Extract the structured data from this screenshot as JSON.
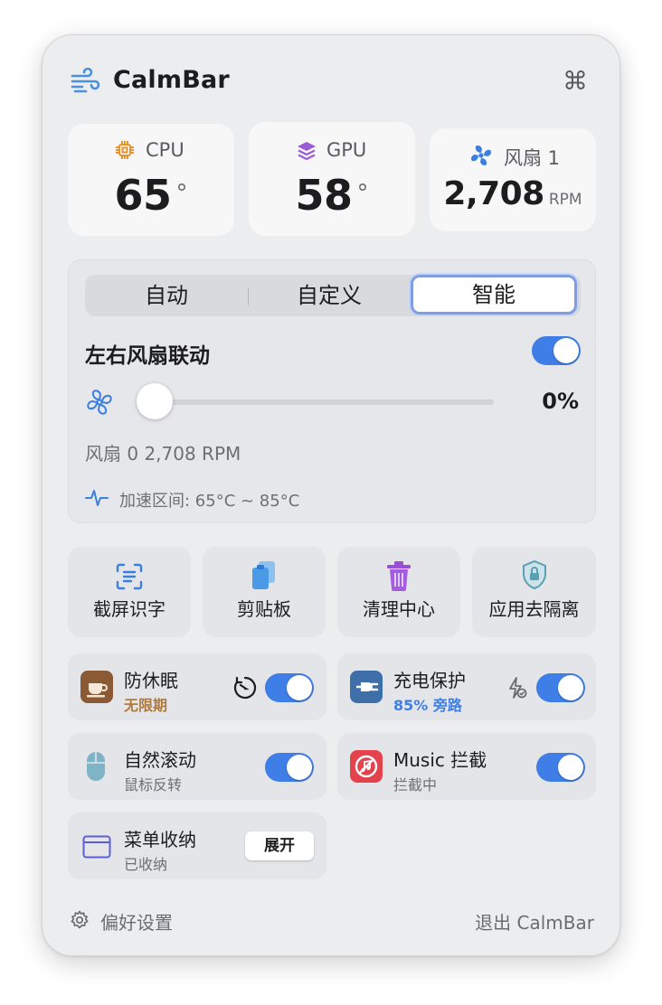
{
  "header": {
    "title": "CalmBar",
    "app_icon": "wind-icon",
    "cmd_icon": "command-icon"
  },
  "stats": {
    "cpu": {
      "label": "CPU",
      "value": "65",
      "unit": "°"
    },
    "gpu": {
      "label": "GPU",
      "value": "58",
      "unit": "°"
    },
    "fan": {
      "label": "风扇 1",
      "value": "2,708",
      "unit": "RPM"
    }
  },
  "fan_control": {
    "modes": [
      "自动",
      "自定义",
      "智能"
    ],
    "selected_mode": "智能",
    "link_label": "左右风扇联动",
    "link_enabled": true,
    "slider_percent": 0,
    "slider_value_label": "0%",
    "fan_info": "风扇 0 2,708 RPM",
    "boost_range": "加速区间: 65°C ~ 85°C"
  },
  "tools": [
    {
      "label": "截屏识字",
      "icon": "text-scan-icon"
    },
    {
      "label": "剪贴板",
      "icon": "clipboard-icon"
    },
    {
      "label": "清理中心",
      "icon": "trash-icon"
    },
    {
      "label": "应用去隔离",
      "icon": "shield-lock-icon"
    }
  ],
  "features": {
    "sleep": {
      "title": "防休眠",
      "sub": "无限期",
      "enabled": true
    },
    "charge": {
      "title": "充电保护",
      "sub": "85% 旁路",
      "enabled": true
    },
    "scroll": {
      "title": "自然滚动",
      "sub": "鼠标反转",
      "enabled": true
    },
    "music": {
      "title": "Music 拦截",
      "sub": "拦截中",
      "enabled": true
    },
    "menu": {
      "title": "菜单收纳",
      "sub": "已收纳",
      "button": "展开"
    }
  },
  "footer": {
    "prefs": "偏好设置",
    "quit": "退出 CalmBar"
  },
  "colors": {
    "accent": "#3f7ee6",
    "sleep_sub": "#b07a3c",
    "charge_sub": "#3f7ee6"
  }
}
